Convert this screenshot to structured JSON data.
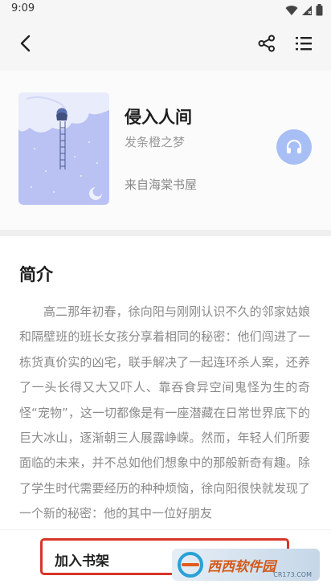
{
  "status_bar": {
    "time": "9:09"
  },
  "book": {
    "title": "侵入人间",
    "author": "发条橙之梦",
    "source": "来自海棠书屋"
  },
  "intro": {
    "heading": "简介",
    "text": "高二那年初春，徐向阳与刚刚认识不久的邻家姑娘和隔壁班的班长女孩分享着相同的秘密：他们闯进了一栋货真价实的凶宅，联手解决了一起连环杀人案，还养了一头长得又大又吓人、靠吞食异空间鬼怪为生的奇怪“宠物”，这一切都像是有一座潜藏在日常世界底下的巨大冰山，逐渐朝三人展露峥嵘。然而，年轻人们所要面临的未来，并不总如他们想象中的那般新奇有趣。除了学生时代需要经历的种种烦恼，徐向阳很快就发现了一个新的秘密：他的其中一位好朋友"
  },
  "bottom_bar": {
    "add_shelf_label": "加入书架"
  },
  "watermark": {
    "text": "西西软件园",
    "sub": "CR173.COM"
  },
  "icons": {
    "back": "back-arrow-icon",
    "share": "share-icon",
    "menu": "catalog-menu-icon",
    "listen": "headphones-icon"
  },
  "colors": {
    "listen_button": "#a7bff5",
    "highlight_border": "#d8352a",
    "cover_background": "#b9c2f3"
  }
}
